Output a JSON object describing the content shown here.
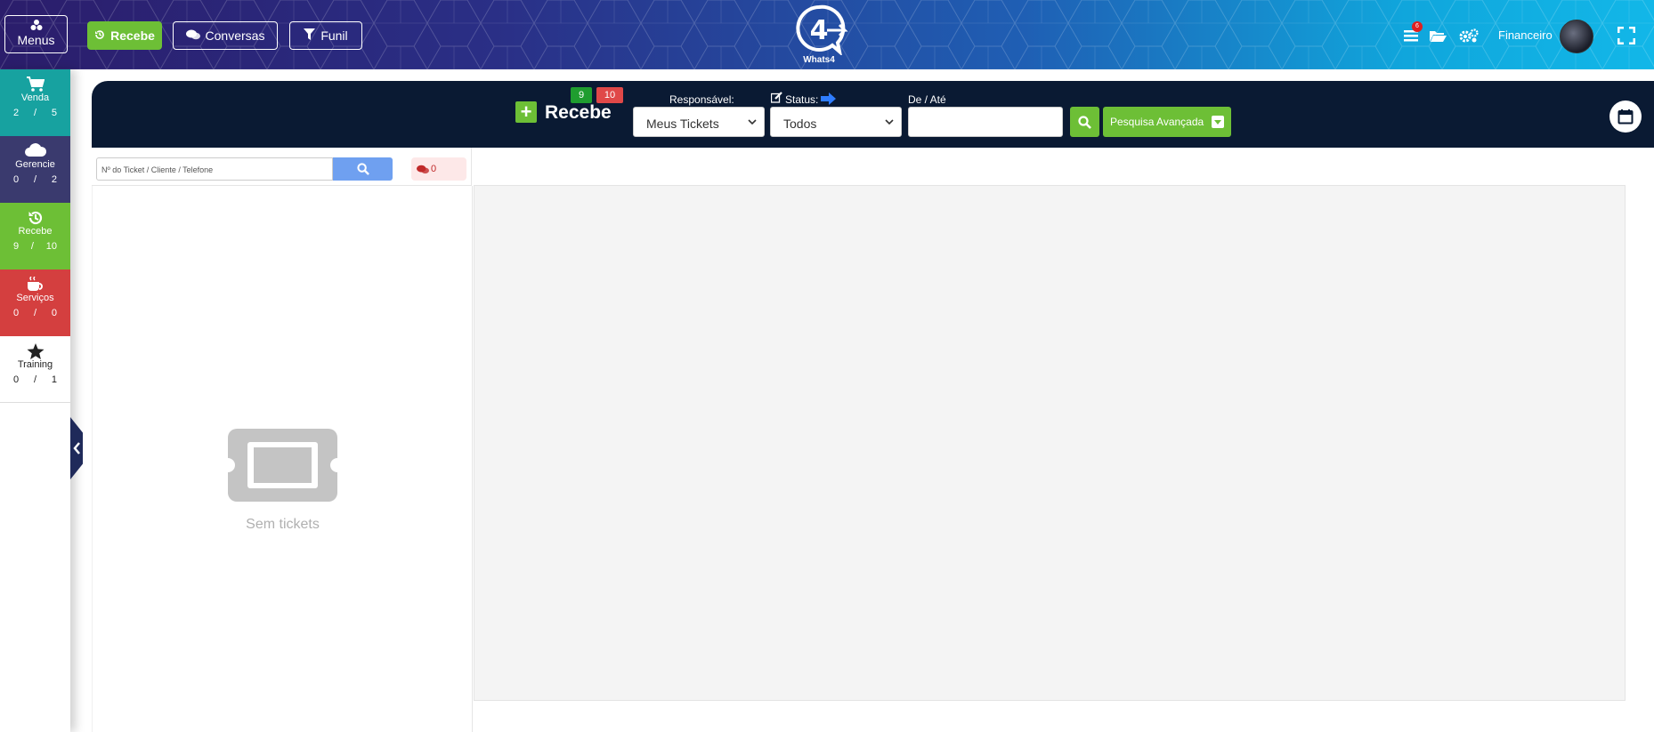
{
  "topbar": {
    "menus_label": "Menus",
    "recebe_label": "Recebe",
    "conversas_label": "Conversas",
    "funil_label": "Funil",
    "logo_text": "Whats4",
    "notification_count": "6",
    "user_name": "Financeiro"
  },
  "sidebar": {
    "items": [
      {
        "label": "Venda",
        "a": "2",
        "sep": "/",
        "b": "5",
        "color": "#17a2a0",
        "icon": "cart-icon"
      },
      {
        "label": "Gerencie",
        "a": "0",
        "sep": "/",
        "b": "2",
        "color": "#3a3a6e",
        "icon": "cloud-icon"
      },
      {
        "label": "Recebe",
        "a": "9",
        "sep": "/",
        "b": "10",
        "color": "#6dbf36",
        "icon": "history-icon"
      },
      {
        "label": "Serviços",
        "a": "0",
        "sep": "/",
        "b": "0",
        "color": "#d43f3f",
        "icon": "coffee-icon"
      },
      {
        "label": "Training",
        "a": "0",
        "sep": "/",
        "b": "1",
        "color": "#ffffff",
        "icon": "star-icon"
      }
    ]
  },
  "header": {
    "title": "Recebe",
    "count_green": "9",
    "count_red": "10",
    "responsavel_label": "Responsável:",
    "responsavel_value": "Meus Tickets",
    "status_label": "Status:",
    "status_value": "Todos",
    "date_label": "De / Até",
    "date_value": "",
    "advanced_search_label": "Pesquisa Avançada"
  },
  "search": {
    "placeholder": "Nº do Ticket / Cliente / Telefone",
    "message_count": "0"
  },
  "empty_state": {
    "text": "Sem tickets"
  }
}
